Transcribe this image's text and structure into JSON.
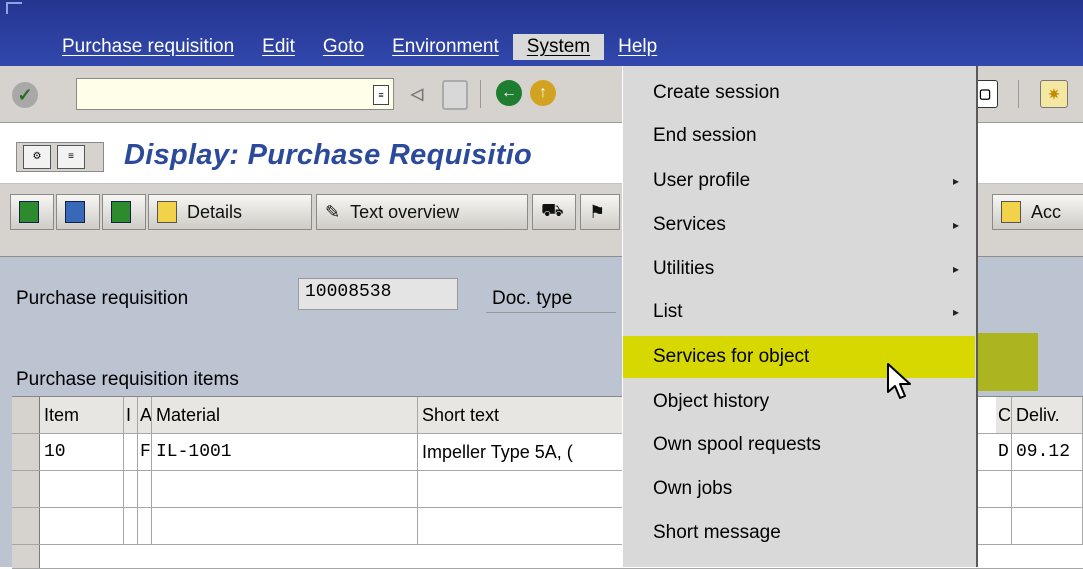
{
  "menubar": {
    "items": [
      {
        "label": "Purchase requisition"
      },
      {
        "label": "Edit"
      },
      {
        "label": "Goto"
      },
      {
        "label": "Environment"
      },
      {
        "label": "System"
      },
      {
        "label": "Help"
      }
    ]
  },
  "header": {
    "title": "Display: Purchase Requisitio"
  },
  "app_toolbar": {
    "details_label": "Details",
    "text_overview_label": "Text overview",
    "acc_label": "Acc"
  },
  "form": {
    "pr_label": "Purchase requisition",
    "pr_value": "10008538",
    "doc_type_label": "Doc. type",
    "items_label": "Purchase requisition items"
  },
  "table": {
    "headers": [
      "Item",
      "I",
      "A",
      "Material",
      "Short text",
      "C",
      "Deliv."
    ],
    "rows": [
      {
        "item": "10",
        "i": "",
        "a": "F",
        "material": "IL-1001",
        "short_text": "Impeller Type 5A, (",
        "c": "D",
        "deliv": "09.12"
      }
    ]
  },
  "system_menu": {
    "items": [
      {
        "label": "Create session",
        "has_submenu": false
      },
      {
        "label": "End session",
        "has_submenu": false
      },
      {
        "label": "User profile",
        "has_submenu": true
      },
      {
        "label": "Services",
        "has_submenu": true
      },
      {
        "label": "Utilities",
        "has_submenu": true
      },
      {
        "label": "List",
        "has_submenu": true
      },
      {
        "label": "Services for object",
        "has_submenu": false
      },
      {
        "label": "Object history",
        "has_submenu": false
      },
      {
        "label": "Own spool requests",
        "has_submenu": false
      },
      {
        "label": "Own jobs",
        "has_submenu": false
      },
      {
        "label": "Short message",
        "has_submenu": false
      }
    ],
    "highlighted": "Services for object"
  },
  "colors": {
    "menubar_bg": "#2b3ea0",
    "title_text": "#2c4a9a",
    "content_bg": "#bcc3d1",
    "highlight": "#d6d800"
  }
}
